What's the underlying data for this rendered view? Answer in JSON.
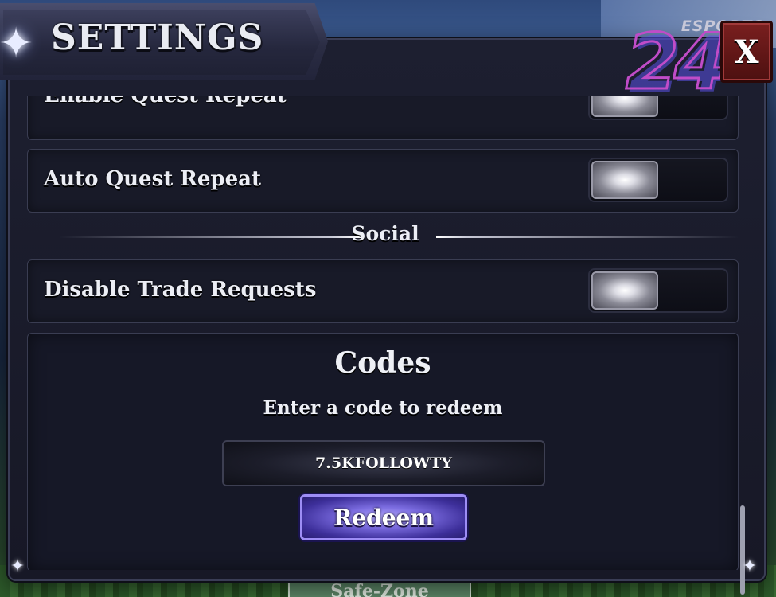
{
  "window": {
    "title": "SETTINGS",
    "close_label": "X"
  },
  "watermark": {
    "brand_text": "ESPORTS",
    "brand_number": "24"
  },
  "settings": {
    "partial_row_label": "Enable Quest Repeat",
    "auto_quest_label": "Auto Quest Repeat",
    "social_section_label": "Social",
    "disable_trade_label": "Disable Trade Requests"
  },
  "codes": {
    "title": "Codes",
    "subtitle": "Enter a code to redeem",
    "input_value": "7.5KFOLLOWTY",
    "redeem_label": "Redeem"
  },
  "world": {
    "zone_sign": "Safe-Zone"
  },
  "colors": {
    "panel_bg": "#1d1f30",
    "redeem_accent": "#7b6ce0",
    "close_red": "#7a1f1f"
  }
}
